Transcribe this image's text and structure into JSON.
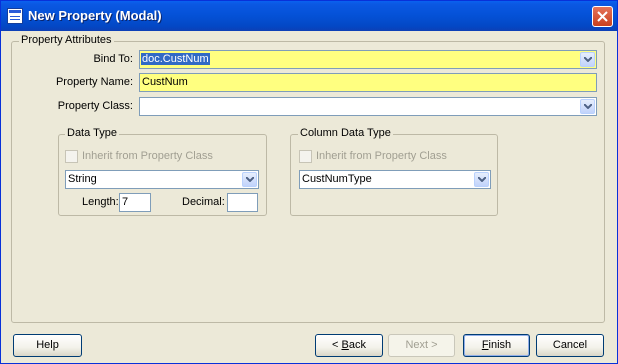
{
  "window": {
    "title": "New Property (Modal)"
  },
  "attributes": {
    "legend": "Property Attributes",
    "bind_to_label": "Bind To:",
    "bind_to_value": "doc.CustNum",
    "property_name_label": "Property Name:",
    "property_name_value": "CustNum",
    "property_class_label": "Property Class:",
    "property_class_value": ""
  },
  "data_type": {
    "legend": "Data Type",
    "inherit_label": "Inherit from Property Class",
    "inherit_checked": false,
    "type_value": "String",
    "length_label": "Length:",
    "length_value": "7",
    "decimal_label": "Decimal:",
    "decimal_value": ""
  },
  "column_data_type": {
    "legend": "Column Data Type",
    "inherit_label": "Inherit from Property Class",
    "inherit_checked": false,
    "type_value": "CustNumType"
  },
  "buttons": {
    "help": "Help",
    "back_prefix": "< ",
    "back_key": "B",
    "back_rest": "ack",
    "next": "Next >",
    "finish_key": "F",
    "finish_rest": "inish",
    "cancel": "Cancel"
  },
  "colors": {
    "highlight": "#ffff80",
    "title_bar": "#0451d6",
    "close": "#c9401d"
  }
}
